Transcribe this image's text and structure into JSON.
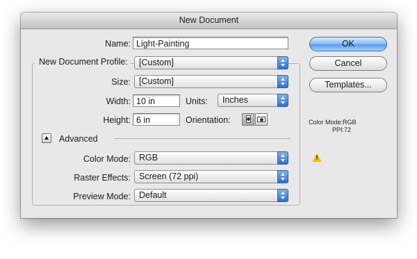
{
  "window": {
    "title": "New Document"
  },
  "name": {
    "label": "Name:",
    "value": "Light-Painting"
  },
  "profile": {
    "label": "New Document Profile:",
    "value": "[Custom]"
  },
  "size": {
    "label": "Size:",
    "value": "[Custom]"
  },
  "width": {
    "label": "Width:",
    "value": "10 in"
  },
  "units": {
    "label": "Units:",
    "value": "Inches"
  },
  "height": {
    "label": "Height:",
    "value": "6 in"
  },
  "orientation": {
    "label": "Orientation:",
    "selected": "portrait",
    "options": [
      "portrait",
      "landscape"
    ]
  },
  "advanced": {
    "label": "Advanced",
    "expanded": true
  },
  "color_mode": {
    "label": "Color Mode:",
    "value": "RGB"
  },
  "raster_effects": {
    "label": "Raster Effects:",
    "value": "Screen (72 ppi)"
  },
  "preview_mode": {
    "label": "Preview Mode:",
    "value": "Default"
  },
  "buttons": {
    "ok": "OK",
    "cancel": "Cancel",
    "templates": "Templates..."
  },
  "info": {
    "color_mode": "Color Mode:RGB",
    "ppi": "PPI:72"
  },
  "icons": {
    "disclosure": "triangle-up-icon",
    "warning": "warning-icon",
    "portrait": "portrait-orientation-icon",
    "landscape": "landscape-orientation-icon"
  },
  "colors": {
    "accent": "#5a9de8",
    "warning": "#f2c200"
  }
}
